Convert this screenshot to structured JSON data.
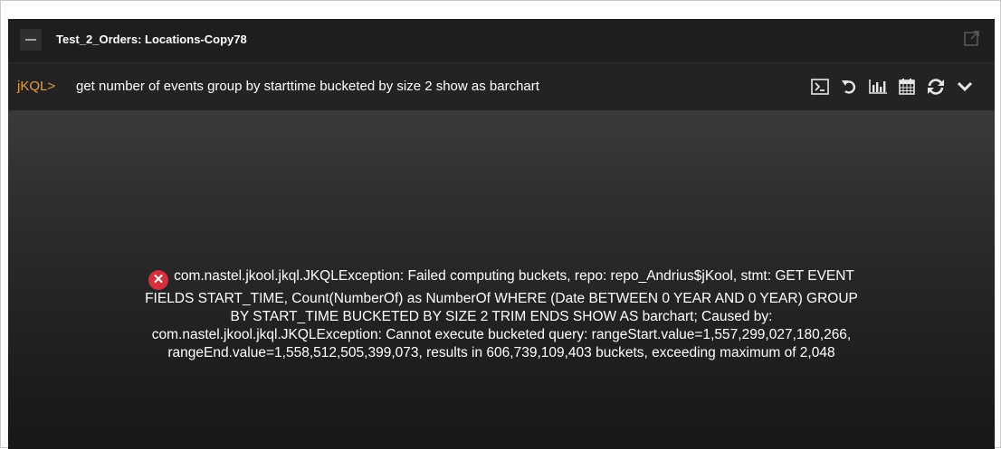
{
  "panel": {
    "title": "Test_2_Orders: Locations-Copy78"
  },
  "query": {
    "prompt": "jKQL>",
    "text": "get number of events group by starttime bucketed by size 2 show as barchart"
  },
  "toolbar": {
    "icons": [
      "console-icon",
      "undo-icon",
      "bar-chart-icon",
      "calendar-icon",
      "refresh-icon",
      "chevron-down-icon"
    ]
  },
  "error": {
    "line1": "com.nastel.jkool.jkql.JKQLException: Failed computing buckets, repo: repo_Andrius$jKool, stmt: GET EVENT",
    "line2": "FIELDS START_TIME, Count(NumberOf) as NumberOf WHERE (Date BETWEEN 0 YEAR AND 0 YEAR) GROUP",
    "line3": "BY START_TIME BUCKETED BY SIZE 2 TRIM ENDS SHOW AS barchart; Caused by:",
    "line4": "com.nastel.jkool.jkql.JKQLException: Cannot execute bucketed query: rangeStart.value=1,557,299,027,180,266,",
    "line5": "rangeEnd.value=1,558,512,505,399,073, results in 606,739,109,403 buckets, exceeding maximum of 2,048"
  },
  "colors": {
    "prompt": "#e49a43",
    "error_icon": "#d6303a",
    "panel_bg": "#1c1c1c"
  }
}
